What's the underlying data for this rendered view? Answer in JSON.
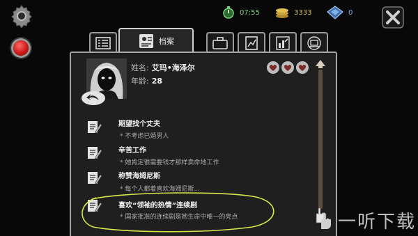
{
  "header": {
    "time": "07:55",
    "money": "3333",
    "gems": "0"
  },
  "tabs": [
    {
      "icon": "list-icon"
    },
    {
      "icon": "dossier-icon",
      "label": "档案",
      "active": true
    },
    {
      "icon": "briefcase-icon"
    },
    {
      "icon": "document-chart-icon"
    },
    {
      "icon": "bar-graph-icon"
    },
    {
      "icon": "laptop-icon"
    }
  ],
  "profile": {
    "name_label": "姓名:",
    "name_value": "艾玛•海泽尔",
    "age_label": "年龄:",
    "age_value": "28",
    "hearts": 3
  },
  "traits": [
    {
      "title": "期望找个丈夫",
      "desc": "* 不考虑已婚男人"
    },
    {
      "title": "辛苦工作",
      "desc": "* 她肯定很需要钱才那样卖命地工作"
    },
    {
      "title": "称赞海姆尼斯",
      "desc": "* 每个人都着喜欢海姆尼斯..."
    },
    {
      "title": "喜欢“领袖的热情”连续剧",
      "desc": "* 国家批准的连续剧是她生命中唯一的亮点"
    }
  ],
  "watermark": {
    "text": "一听下载"
  },
  "colors": {
    "accent_gold": "#d9c35a",
    "time_green": "#7fd57f",
    "gem_blue": "#7fb2e6",
    "annotation": "#d8e84a"
  }
}
